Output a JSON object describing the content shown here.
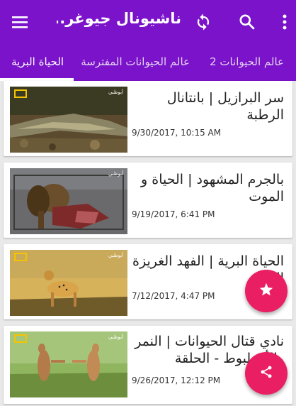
{
  "appbar": {
    "title": "ناشيونال جيوغر...",
    "icons": [
      "menu-icon",
      "refresh-icon",
      "search-icon",
      "more-vert-icon"
    ]
  },
  "tabs": [
    {
      "label": "عالم الحيوانات 2",
      "selected": false
    },
    {
      "label": "عالم الحيوانات المفترسة",
      "selected": false
    },
    {
      "label": "الحياة البرية",
      "selected": true
    }
  ],
  "items": [
    {
      "title": "سر البرازيل | بانتانال الرطبة",
      "date": "9/30/2017, 10:15 AM",
      "thumb_badge": "أبوظبي"
    },
    {
      "title": "بالجرم المشهود | الحياة و الموت",
      "date": "9/19/2017, 6:41 PM",
      "thumb_badge": "أبوظبي"
    },
    {
      "title": "الحياة البرية | الفهد الغريزة القاتلة",
      "date": "7/12/2017, 4:47 PM",
      "thumb_badge": "أبوظبي"
    },
    {
      "title": "نادي قتال الحيوانات | النمر والأخطبوط - الحلقة",
      "date": "9/26/2017, 12:12 PM",
      "thumb_badge": "أبوظبي"
    }
  ],
  "fabs": {
    "favorite_icon": "star-icon",
    "share_icon": "share-icon"
  },
  "colors": {
    "primary": "#7a13c9",
    "accent": "#e91e63"
  }
}
